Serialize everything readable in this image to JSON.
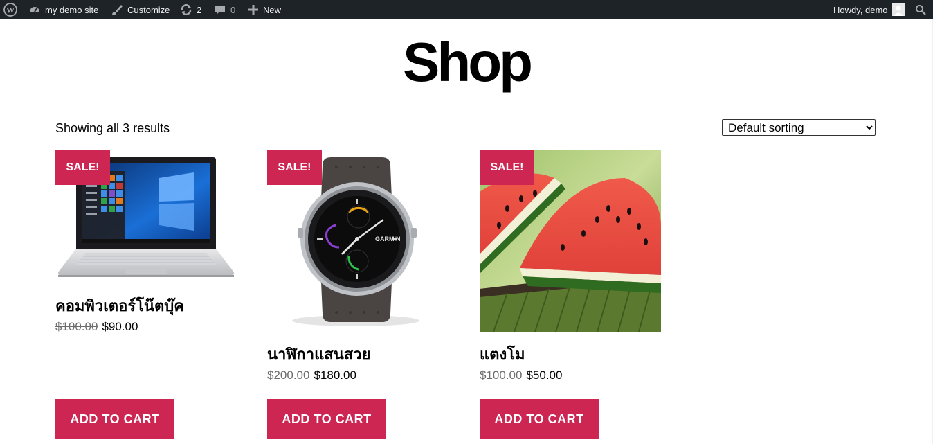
{
  "adminbar": {
    "site_name": "my demo site",
    "customize": "Customize",
    "updates_count": "2",
    "comments_count": "0",
    "new_label": "New",
    "howdy": "Howdy, demo"
  },
  "page": {
    "title": "Shop",
    "result_count": "Showing all 3 results",
    "sorting": {
      "selected": "Default sorting",
      "options": [
        "Default sorting"
      ]
    }
  },
  "products": [
    {
      "sale_badge": "SALE!",
      "title": "คอมพิวเตอร์โน๊ตบุ๊ค",
      "old_price": "$100.00",
      "new_price": "$90.00",
      "button": "ADD TO CART",
      "image": "laptop"
    },
    {
      "sale_badge": "SALE!",
      "title": "นาฬิกาแสนสวย",
      "old_price": "$200.00",
      "new_price": "$180.00",
      "button": "ADD TO CART",
      "image": "watch"
    },
    {
      "sale_badge": "SALE!",
      "title": "แตงโม",
      "old_price": "$100.00",
      "new_price": "$50.00",
      "button": "ADD TO CART",
      "image": "watermelon"
    }
  ],
  "colors": {
    "admin_bar": "#1d2327",
    "accent": "#cd2653",
    "text": "#000000"
  }
}
